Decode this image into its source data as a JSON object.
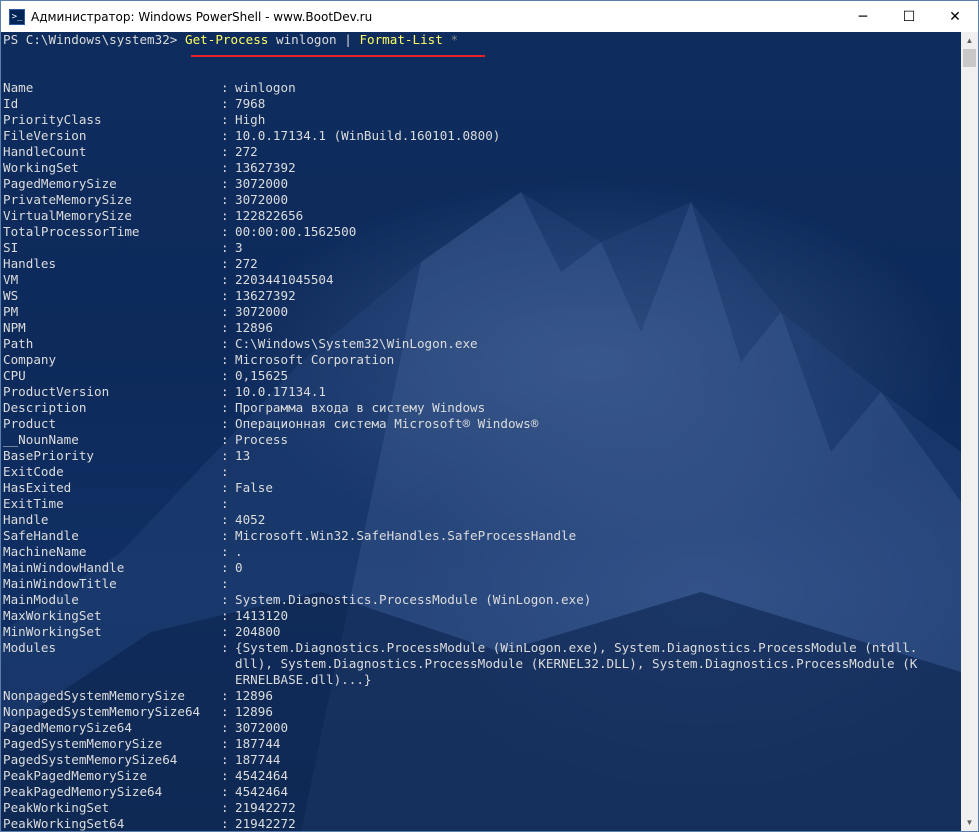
{
  "window": {
    "title": "Администратор: Windows PowerShell - www.BootDev.ru"
  },
  "controls": {
    "minimize": "─",
    "maximize": "☐",
    "close": "✕"
  },
  "prompt": {
    "path": "PS C:\\Windows\\system32>",
    "cmd1": "Get-Process",
    "arg": "winlogon",
    "pipe": "|",
    "cmd2": "Format-List",
    "star": "*"
  },
  "props": [
    [
      "Name",
      "winlogon"
    ],
    [
      "Id",
      "7968"
    ],
    [
      "PriorityClass",
      "High"
    ],
    [
      "FileVersion",
      "10.0.17134.1 (WinBuild.160101.0800)"
    ],
    [
      "HandleCount",
      "272"
    ],
    [
      "WorkingSet",
      "13627392"
    ],
    [
      "PagedMemorySize",
      "3072000"
    ],
    [
      "PrivateMemorySize",
      "3072000"
    ],
    [
      "VirtualMemorySize",
      "122822656"
    ],
    [
      "TotalProcessorTime",
      "00:00:00.1562500"
    ],
    [
      "SI",
      "3"
    ],
    [
      "Handles",
      "272"
    ],
    [
      "VM",
      "2203441045504"
    ],
    [
      "WS",
      "13627392"
    ],
    [
      "PM",
      "3072000"
    ],
    [
      "NPM",
      "12896"
    ],
    [
      "Path",
      "C:\\Windows\\System32\\WinLogon.exe"
    ],
    [
      "Company",
      "Microsoft Corporation"
    ],
    [
      "CPU",
      "0,15625"
    ],
    [
      "ProductVersion",
      "10.0.17134.1"
    ],
    [
      "Description",
      "Программа входа в систему Windows"
    ],
    [
      "Product",
      "Операционная система Microsoft® Windows®"
    ],
    [
      "__NounName",
      "Process"
    ],
    [
      "BasePriority",
      "13"
    ],
    [
      "ExitCode",
      ""
    ],
    [
      "HasExited",
      "False"
    ],
    [
      "ExitTime",
      ""
    ],
    [
      "Handle",
      "4052"
    ],
    [
      "SafeHandle",
      "Microsoft.Win32.SafeHandles.SafeProcessHandle"
    ],
    [
      "MachineName",
      "."
    ],
    [
      "MainWindowHandle",
      "0"
    ],
    [
      "MainWindowTitle",
      ""
    ],
    [
      "MainModule",
      "System.Diagnostics.ProcessModule (WinLogon.exe)"
    ],
    [
      "MaxWorkingSet",
      "1413120"
    ],
    [
      "MinWorkingSet",
      "204800"
    ],
    [
      "Modules",
      "{System.Diagnostics.ProcessModule (WinLogon.exe), System.Diagnostics.ProcessModule (ntdll."
    ],
    [
      "",
      "dll), System.Diagnostics.ProcessModule (KERNEL32.DLL), System.Diagnostics.ProcessModule (K"
    ],
    [
      "",
      "ERNELBASE.dll)...}"
    ],
    [
      "NonpagedSystemMemorySize",
      "12896"
    ],
    [
      "NonpagedSystemMemorySize64",
      "12896"
    ],
    [
      "PagedMemorySize64",
      "3072000"
    ],
    [
      "PagedSystemMemorySize",
      "187744"
    ],
    [
      "PagedSystemMemorySize64",
      "187744"
    ],
    [
      "PeakPagedMemorySize",
      "4542464"
    ],
    [
      "PeakPagedMemorySize64",
      "4542464"
    ],
    [
      "PeakWorkingSet",
      "21942272"
    ],
    [
      "PeakWorkingSet64",
      "21942272"
    ]
  ]
}
